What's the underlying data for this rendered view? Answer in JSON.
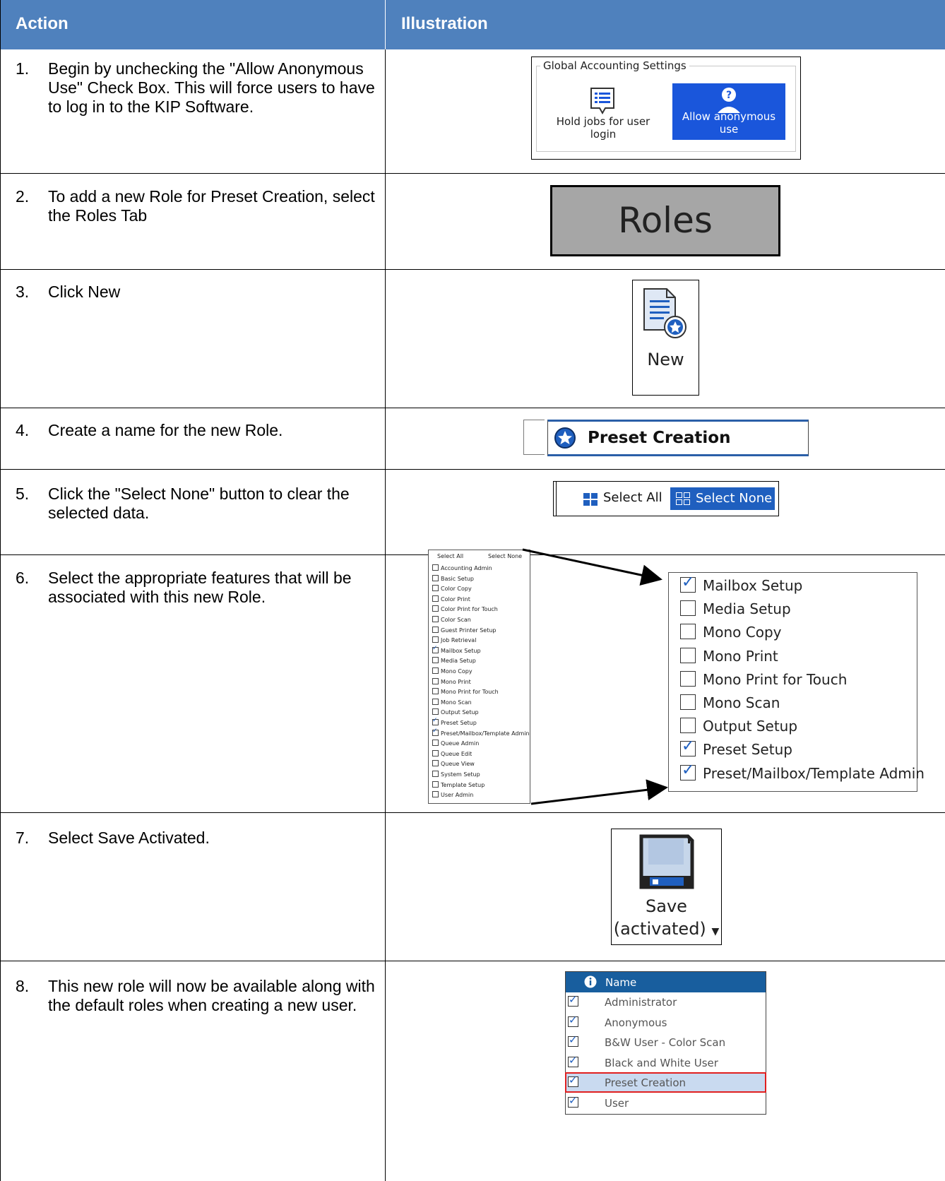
{
  "table": {
    "headers": {
      "action": "Action",
      "illustration": "Illustration"
    },
    "steps": [
      {
        "num": "1.",
        "text": "Begin by unchecking the \"Allow Anonymous Use\" Check Box. This will force users to have to log in to the KIP Software."
      },
      {
        "num": "2.",
        "text": "To add a new Role for Preset Creation, select the Roles Tab"
      },
      {
        "num": "3.",
        "text": "Click New"
      },
      {
        "num": "4.",
        "text": "Create a name for the new Role."
      },
      {
        "num": "5.",
        "text": "Click the \"Select None\" button to clear the selected data."
      },
      {
        "num": "6.",
        "text": "Select the appropriate features that will be associated with this new Role."
      },
      {
        "num": "7.",
        "text": "Select Save Activated."
      },
      {
        "num": "8.",
        "text": "This new role will now be available along with the default roles when creating a new user."
      }
    ]
  },
  "global_accounting": {
    "legend": "Global Accounting Settings",
    "hold_label": "Hold jobs for user login",
    "anon_label": "Allow anonymous use",
    "hold_icon": "list-document-icon",
    "anon_icon": "anonymous-user-icon",
    "active_color": "#1a56db"
  },
  "roles_tab": {
    "label": "Roles"
  },
  "new_button": {
    "label": "New",
    "icon": "new-document-star-icon"
  },
  "role_name": {
    "value": "Preset Creation",
    "icon": "star-badge-icon"
  },
  "select_bar": {
    "all_label": "Select All",
    "none_label": "Select None"
  },
  "feature_list_small": {
    "select_all": "Select All",
    "select_none": "Select None",
    "items": [
      {
        "label": "Accounting Admin",
        "checked": false
      },
      {
        "label": "Basic Setup",
        "checked": false
      },
      {
        "label": "Color Copy",
        "checked": false
      },
      {
        "label": "Color Print",
        "checked": false
      },
      {
        "label": "Color Print for Touch",
        "checked": false
      },
      {
        "label": "Color Scan",
        "checked": false
      },
      {
        "label": "Guest Printer Setup",
        "checked": false
      },
      {
        "label": "Job Retrieval",
        "checked": false
      },
      {
        "label": "Mailbox Setup",
        "checked": true
      },
      {
        "label": "Media Setup",
        "checked": false
      },
      {
        "label": "Mono Copy",
        "checked": false
      },
      {
        "label": "Mono Print",
        "checked": false
      },
      {
        "label": "Mono Print for Touch",
        "checked": false
      },
      {
        "label": "Mono Scan",
        "checked": false
      },
      {
        "label": "Output Setup",
        "checked": false
      },
      {
        "label": "Preset Setup",
        "checked": true
      },
      {
        "label": "Preset/Mailbox/Template Admin",
        "checked": true
      },
      {
        "label": "Queue Admin",
        "checked": false
      },
      {
        "label": "Queue Edit",
        "checked": false
      },
      {
        "label": "Queue View",
        "checked": false
      },
      {
        "label": "System Setup",
        "checked": false
      },
      {
        "label": "Template Setup",
        "checked": false
      },
      {
        "label": "User Admin",
        "checked": false
      }
    ]
  },
  "feature_list_zoom": {
    "items": [
      {
        "label": "Mailbox Setup",
        "checked": true
      },
      {
        "label": "Media Setup",
        "checked": false
      },
      {
        "label": "Mono Copy",
        "checked": false
      },
      {
        "label": "Mono Print",
        "checked": false
      },
      {
        "label": "Mono Print for Touch",
        "checked": false
      },
      {
        "label": "Mono Scan",
        "checked": false
      },
      {
        "label": "Output Setup",
        "checked": false
      },
      {
        "label": "Preset Setup",
        "checked": true
      },
      {
        "label": "Preset/Mailbox/Template Admin",
        "checked": true
      }
    ]
  },
  "save_button": {
    "line1": "Save",
    "line2": "(activated)",
    "icon": "floppy-disk-icon"
  },
  "name_list": {
    "header": "Name",
    "header_icon": "info-icon",
    "rows": [
      {
        "label": "Administrator",
        "selected": false
      },
      {
        "label": "Anonymous",
        "selected": false
      },
      {
        "label": "B&W User - Color Scan",
        "selected": false
      },
      {
        "label": "Black and White User",
        "selected": false
      },
      {
        "label": "Preset Creation",
        "selected": true
      },
      {
        "label": "User",
        "selected": false
      }
    ]
  },
  "colors": {
    "header_bg": "#4f81bd",
    "accent_blue": "#1f5fbf",
    "highlight_red": "#e02020"
  }
}
